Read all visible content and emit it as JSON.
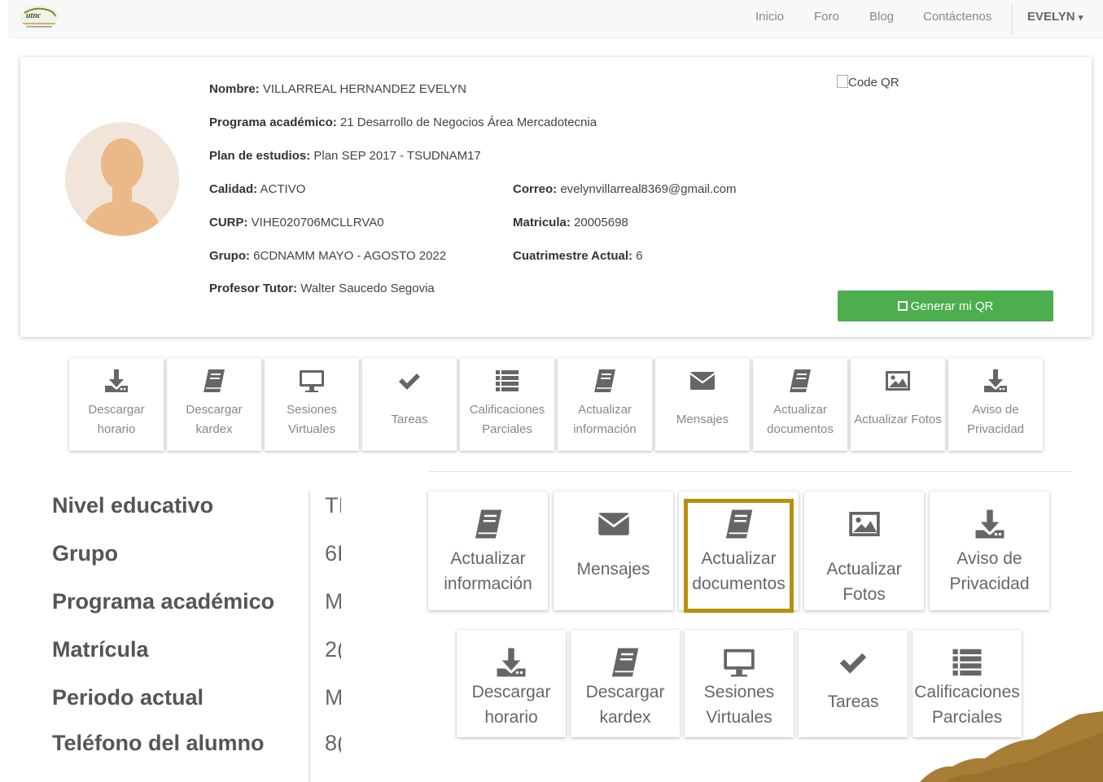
{
  "nav": {
    "links": [
      "Inicio",
      "Foro",
      "Blog",
      "Contáctenos"
    ],
    "user": "EVELYN",
    "user_caret": "▾"
  },
  "profile": {
    "nombre_label": "Nombre:",
    "nombre": "VILLARREAL HERNANDEZ EVELYN",
    "programa_label": "Programa académico:",
    "programa": "21 Desarrollo de Negocios Área Mercadotecnia",
    "plan_label": "Plan de estudios:",
    "plan": "Plan SEP 2017 - TSUDNAM17",
    "calidad_label": "Calidad:",
    "calidad": "ACTIVO",
    "curp_label": "CURP:",
    "curp": "VIHE020706MCLLRVA0",
    "grupo_label": "Grupo:",
    "grupo": "6CDNAMM MAYO - AGOSTO 2022",
    "tutor_label": "Profesor Tutor:",
    "tutor": "Walter Saucedo Segovia",
    "correo_label": "Correo:",
    "correo": "evelynvillarreal8369@gmail.com",
    "matricula_label": "Matricula:",
    "matricula": "20005698",
    "cuatrimestre_label": "Cuatrimestre Actual:",
    "cuatrimestre": "6",
    "qr_alt": "Code QR",
    "qr_button": "Generar mi QR",
    "qr_icon": "qrcode-icon"
  },
  "tiles_small": [
    {
      "icon": "download-icon",
      "line1": "Descargar",
      "line2": "horario"
    },
    {
      "icon": "book-icon",
      "line1": "Descargar",
      "line2": "kardex"
    },
    {
      "icon": "monitor-icon",
      "line1": "Sesiones",
      "line2": "Virtuales"
    },
    {
      "icon": "check-icon",
      "line1": "Tareas",
      "line2": ""
    },
    {
      "icon": "list-icon",
      "line1": "Calificaciones",
      "line2": "Parciales"
    },
    {
      "icon": "book-icon",
      "line1": "Actualizar",
      "line2": "información"
    },
    {
      "icon": "envelope-icon",
      "line1": "Mensajes",
      "line2": ""
    },
    {
      "icon": "book-icon",
      "line1": "Actualizar",
      "line2": "documentos"
    },
    {
      "icon": "picture-icon",
      "line1": "Actualizar Fotos",
      "line2": ""
    },
    {
      "icon": "download-icon",
      "line1": "Aviso de",
      "line2": "Privacidad"
    }
  ],
  "info": [
    {
      "label": "Nivel educativo",
      "value": "TI"
    },
    {
      "label": "Grupo",
      "value": "6I"
    },
    {
      "label": "Programa académico",
      "value": "M"
    },
    {
      "label": "Matrícula",
      "value": "2("
    },
    {
      "label": "Periodo actual",
      "value": "M"
    },
    {
      "label": "Teléfono del alumno",
      "value": "8("
    }
  ],
  "tiles_large_row1": [
    {
      "icon": "book-icon",
      "line1": "Actualizar",
      "line2": "información"
    },
    {
      "icon": "envelope-icon",
      "line1": "Mensajes",
      "line2": ""
    },
    {
      "icon": "book-icon",
      "line1": "Actualizar",
      "line2": "documentos",
      "highlighted": true
    },
    {
      "icon": "picture-icon",
      "line1": "Actualizar Fotos",
      "line2": ""
    },
    {
      "icon": "download-icon",
      "line1": "Aviso de",
      "line2": "Privacidad"
    }
  ],
  "tiles_large_row2": [
    {
      "icon": "download-icon",
      "line1": "Descargar",
      "line2": "horario"
    },
    {
      "icon": "book-icon",
      "line1": "Descargar",
      "line2": "kardex"
    },
    {
      "icon": "monitor-icon",
      "line1": "Sesiones",
      "line2": "Virtuales"
    },
    {
      "icon": "check-icon",
      "line1": "Tareas",
      "line2": ""
    },
    {
      "icon": "list-icon",
      "line1": "Calificaciones",
      "line2": "Parciales"
    }
  ],
  "colors": {
    "qr_button": "#4cae4c",
    "highlight_border": "#b8900a",
    "icon_gray": "#666666"
  }
}
